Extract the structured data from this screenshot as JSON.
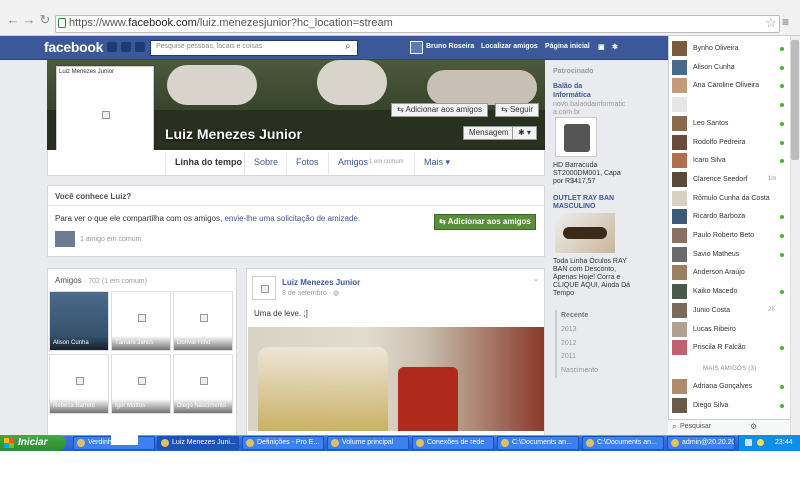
{
  "browser": {
    "url_prefix": "https://www.",
    "url_host": "facebook.com",
    "url_path": "/luiz.menezesjunior?hc_location=stream"
  },
  "fbbar": {
    "logo": "facebook",
    "search_placeholder": "Pesquise pessoas, locais e coisas",
    "user_name": "Bruno Roseira",
    "find_friends": "Localizar amigos",
    "home": "Página inicial"
  },
  "profile": {
    "name": "Luiz Menezes Junior",
    "pic_label": "Luiz Menezes Junior",
    "add_friend": "Adicionar aos amigos",
    "follow": "Seguir",
    "message": "Mensagem",
    "tabs": [
      "Linha do tempo",
      "Sobre",
      "Fotos",
      "Amigos",
      "Mais"
    ],
    "friends_tab_sub": "1 em comum"
  },
  "know": {
    "heading": "Você conhece Luiz?",
    "text": "Para ver o que ele compartilha com os amigos,",
    "link": "envie-lhe uma solicitação de amizade.",
    "button": "Adicionar aos amigos",
    "mutual": "1 amigo em comum"
  },
  "friends": {
    "heading": "Amigos",
    "count": "· 702 (1 em comum)",
    "items": [
      "Alison Cunha",
      "Tâmara Janos",
      "Dorival Filho",
      "Rebeca Barreto",
      "Igor Mattos",
      "Diego Nascimento"
    ]
  },
  "post": {
    "author": "Luiz Menezes Junior",
    "date": "8 de setembro",
    "text": "Uma de leve. ;]"
  },
  "ads": {
    "sponsored": "Patrocinado",
    "ad1_title1": "Balão da",
    "ad1_title2": "Informática",
    "ad1_url1": "novo.balaodainformatic",
    "ad1_url2": "a.com.br",
    "ad1_text": [
      "HD Barracuda",
      "ST2000DM001, Capa",
      "por R$417,57"
    ],
    "ad2_title1": "OUTLET RAY BAN",
    "ad2_title2": "MASCULINO",
    "ad2_text": [
      "Toda Linha Óculos RAY",
      "BAN com Desconto,",
      "Apenas Hoje! Corra e",
      "CLIQUE AQUI, Ainda Dá",
      "Tempo"
    ]
  },
  "timeline_years": [
    "Recente",
    "2013",
    "2012",
    "2011",
    "Nascimento"
  ],
  "chat": {
    "contacts": [
      {
        "name": "Bynho Oliveira",
        "status": "online"
      },
      {
        "name": "Alison Cunha",
        "status": "online"
      },
      {
        "name": "Ana Caroline Oliveira",
        "status": "online"
      },
      {
        "name": "",
        "status": "online"
      },
      {
        "name": "Leo Santos",
        "status": "online"
      },
      {
        "name": "Rodolfo Pedreira",
        "status": "online"
      },
      {
        "name": "Icaro Silva",
        "status": "online"
      },
      {
        "name": "Clarence Seedorf",
        "status": "1m"
      },
      {
        "name": "Rômulo Cunha da Costa",
        "status": ""
      },
      {
        "name": "Ricardo Barboza",
        "status": "online"
      },
      {
        "name": "Paulo Roberto Beto",
        "status": "online"
      },
      {
        "name": "Savio Matheus",
        "status": "online"
      },
      {
        "name": "Anderson Araújo",
        "status": ""
      },
      {
        "name": "Kaiko Macedo",
        "status": "online"
      },
      {
        "name": "Junio Costa",
        "status": "2h"
      },
      {
        "name": "Lucas Ribeiro",
        "status": ""
      },
      {
        "name": "Priscila R Falcão",
        "status": "online"
      }
    ],
    "more_label": "MAIS AMIGOS (3)",
    "more": [
      {
        "name": "Adriana Gonçalves",
        "status": "online"
      },
      {
        "name": "Diego Silva",
        "status": "online"
      }
    ],
    "search_placeholder": "Pesquisar"
  },
  "taskbar": {
    "start": "Iniciar",
    "items": [
      "Verdinho",
      "Luiz Menezes Juni...",
      "Definições - Pro E...",
      "Volume principal",
      "Conexões de rede",
      "C:\\Documents an...",
      "C:\\Documents an...",
      "admin@20.20.20..."
    ],
    "clock": "23:44"
  },
  "colors": {
    "fb_blue": "#3b5998",
    "green_button": "#5b8c3a",
    "online": "#42b72a"
  }
}
